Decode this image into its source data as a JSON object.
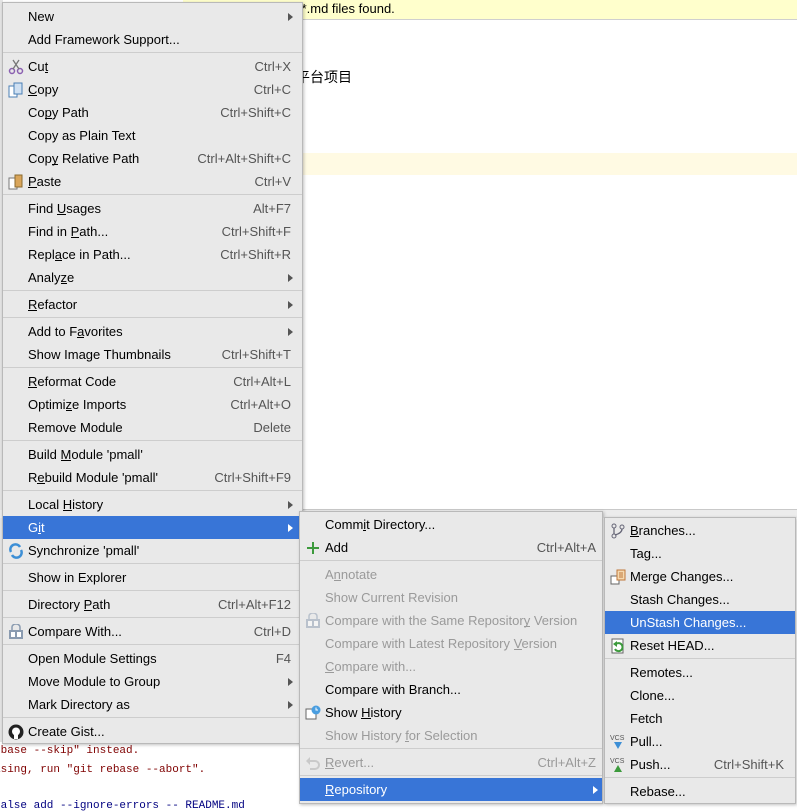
{
  "background": {
    "banner_text": "Plugins supporting *.md files found.",
    "editor_text": "口和管理平台项目",
    "console_lines": [
      {
        "text": "ebase --skip\" instead.",
        "color": "#7f0000"
      },
      {
        "text": "asing, run \"git rebase --abort\".",
        "color": "#7f0000"
      },
      {
        "text": "false add --ignore-errors -- README.md",
        "color": "#000080"
      }
    ]
  },
  "colors": {
    "highlight": "#3875d7",
    "menu_bg": "#e9e9e9",
    "disabled": "#9a9a9a"
  },
  "context_menu": [
    {
      "label": "New",
      "submenu": true
    },
    {
      "label": "Add Framework Support..."
    },
    {
      "sep": true
    },
    {
      "label": "Cut",
      "mn": 2,
      "shortcut": "Ctrl+X",
      "icon": "scissors-icon"
    },
    {
      "label": "Copy",
      "mn": 0,
      "shortcut": "Ctrl+C",
      "icon": "copy-icon"
    },
    {
      "label": "Copy Path",
      "mn": 2,
      "shortcut": "Ctrl+Shift+C"
    },
    {
      "label": "Copy as Plain Text"
    },
    {
      "label": "Copy Relative Path",
      "mn": 3,
      "shortcut": "Ctrl+Alt+Shift+C"
    },
    {
      "label": "Paste",
      "mn": 0,
      "shortcut": "Ctrl+V",
      "icon": "paste-icon"
    },
    {
      "sep": true
    },
    {
      "label": "Find Usages",
      "mn": 5,
      "shortcut": "Alt+F7"
    },
    {
      "label": "Find in Path...",
      "mn": 8,
      "shortcut": "Ctrl+Shift+F"
    },
    {
      "label": "Replace in Path...",
      "mn": 4,
      "shortcut": "Ctrl+Shift+R"
    },
    {
      "label": "Analyze",
      "mn": 5,
      "submenu": true
    },
    {
      "sep": true
    },
    {
      "label": "Refactor",
      "mn": 0,
      "submenu": true
    },
    {
      "sep": true
    },
    {
      "label": "Add to Favorites",
      "mn": 8,
      "submenu": true
    },
    {
      "label": "Show Image Thumbnails",
      "shortcut": "Ctrl+Shift+T"
    },
    {
      "sep": true
    },
    {
      "label": "Reformat Code",
      "mn": 0,
      "shortcut": "Ctrl+Alt+L"
    },
    {
      "label": "Optimize Imports",
      "mn": 6,
      "shortcut": "Ctrl+Alt+O"
    },
    {
      "label": "Remove Module",
      "shortcut": "Delete"
    },
    {
      "sep": true
    },
    {
      "label": "Build Module 'pmall'",
      "mn": 6
    },
    {
      "label": "Rebuild Module 'pmall'",
      "mn": 1,
      "shortcut": "Ctrl+Shift+F9"
    },
    {
      "sep": true
    },
    {
      "label": "Local History",
      "mn": 6,
      "submenu": true
    },
    {
      "label": "Git",
      "mn": 1,
      "submenu": true,
      "selected": true
    },
    {
      "label": "Synchronize 'pmall'",
      "icon": "synchronize-icon"
    },
    {
      "sep": true
    },
    {
      "label": "Show in Explorer"
    },
    {
      "sep": true
    },
    {
      "label": "Directory Path",
      "mn": 10,
      "shortcut": "Ctrl+Alt+F12"
    },
    {
      "sep": true
    },
    {
      "label": "Compare With...",
      "shortcut": "Ctrl+D",
      "icon": "compare-icon"
    },
    {
      "sep": true
    },
    {
      "label": "Open Module Settings",
      "shortcut": "F4"
    },
    {
      "label": "Move Module to Group",
      "submenu": true
    },
    {
      "label": "Mark Directory as",
      "submenu": true
    },
    {
      "sep": true
    },
    {
      "label": "Create Gist...",
      "icon": "github-icon"
    }
  ],
  "git_menu": [
    {
      "label": "Commit Directory...",
      "mn": 4
    },
    {
      "label": "Add",
      "shortcut": "Ctrl+Alt+A",
      "icon": "plus-icon"
    },
    {
      "sep": true
    },
    {
      "label": "Annotate",
      "mn": 1,
      "disabled": true
    },
    {
      "label": "Show Current Revision",
      "disabled": true
    },
    {
      "label": "Compare with the Same Repository Version",
      "mn": 31,
      "disabled": true,
      "icon": "compare-icon"
    },
    {
      "label": "Compare with Latest Repository Version",
      "mn": 31,
      "disabled": true
    },
    {
      "label": "Compare with...",
      "mn": 0,
      "disabled": true
    },
    {
      "label": "Compare with Branch..."
    },
    {
      "label": "Show History",
      "mn": 5,
      "icon": "history-icon"
    },
    {
      "label": "Show History for Selection",
      "mn": 13,
      "disabled": true
    },
    {
      "sep": true
    },
    {
      "label": "Revert...",
      "mn": 0,
      "shortcut": "Ctrl+Alt+Z",
      "disabled": true,
      "icon": "revert-icon"
    },
    {
      "sep": true
    },
    {
      "label": "Repository",
      "mn": 0,
      "submenu": true,
      "selected": true
    }
  ],
  "repository_menu": [
    {
      "label": "Branches...",
      "mn": 0,
      "icon": "branches-icon"
    },
    {
      "label": "Tag..."
    },
    {
      "label": "Merge Changes...",
      "icon": "merge-icon"
    },
    {
      "label": "Stash Changes..."
    },
    {
      "label": "UnStash Changes...",
      "selected": true
    },
    {
      "label": "Reset HEAD...",
      "icon": "reset-icon"
    },
    {
      "sep": true
    },
    {
      "label": "Remotes..."
    },
    {
      "label": "Clone..."
    },
    {
      "label": "Fetch"
    },
    {
      "label": "Pull...",
      "icon": "vcs-pull-icon"
    },
    {
      "label": "Push...",
      "shortcut": "Ctrl+Shift+K",
      "icon": "vcs-push-icon"
    },
    {
      "sep": true
    },
    {
      "label": "Rebase..."
    }
  ]
}
